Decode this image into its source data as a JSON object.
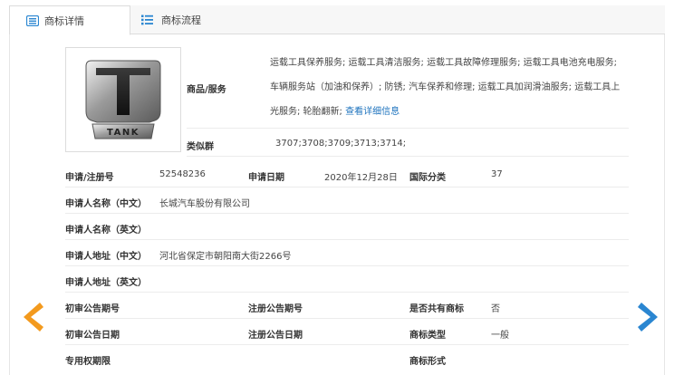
{
  "tabs": [
    {
      "label": "商标详情",
      "active": true,
      "icon": "list-doc-icon"
    },
    {
      "label": "商标流程",
      "active": false,
      "icon": "list-bullets-icon"
    }
  ],
  "logo": {
    "text": "TANK"
  },
  "goods": {
    "label": "商品/服务",
    "text": "运载工具保养服务; 运载工具清洁服务; 运载工具故障修理服务; 运载工具电池充电服务; 车辆服务站（加油和保养）; 防锈; 汽车保养和修理; 运载工具加润滑油服务; 运载工具上光服务; 轮胎翻新;",
    "link": "查看详细信息"
  },
  "similar_group": {
    "label": "类似群",
    "value": "3707;3708;3709;3713;3714;"
  },
  "fields": {
    "reg_no_label": "申请/注册号",
    "reg_no": "52548236",
    "apply_date_label": "申请日期",
    "apply_date": "2020年12月28日",
    "intl_class_label": "国际分类",
    "intl_class": "37",
    "applicant_cn_label": "申请人名称（中文）",
    "applicant_cn": "长城汽车股份有限公司",
    "applicant_en_label": "申请人名称（英文）",
    "applicant_en": "",
    "address_cn_label": "申请人地址（中文）",
    "address_cn": "河北省保定市朝阳南大街2266号",
    "address_en_label": "申请人地址（英文）",
    "address_en": "",
    "prelim_issue_label": "初审公告期号",
    "prelim_issue": "",
    "reg_issue_label": "注册公告期号",
    "reg_issue": "",
    "shared_label": "是否共有商标",
    "shared": "否",
    "prelim_date_label": "初审公告日期",
    "prelim_date": "",
    "reg_date_label": "注册公告日期",
    "reg_date": "",
    "type_label": "商标类型",
    "type": "一般",
    "exclusive_label": "专用权期限",
    "exclusive": "",
    "form_label": "商标形式",
    "form": ""
  },
  "colors": {
    "prev_arrow": "#f39a1e",
    "next_arrow": "#2a86d1",
    "link": "#1e73be"
  }
}
